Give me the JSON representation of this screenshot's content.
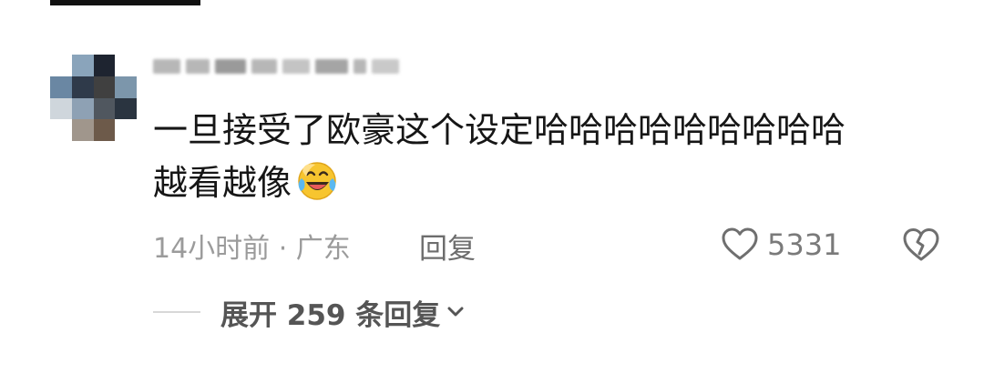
{
  "comment": {
    "text_line1": "一旦接受了欧豪这个设定哈哈哈哈哈哈哈哈哈",
    "text_line2": "越看越像",
    "emoji": "laughing-crying-emoji"
  },
  "meta": {
    "time_location": "14小时前 · 广东",
    "reply_label": "回复"
  },
  "actions": {
    "like_count": "5331",
    "like_icon": "heart-outline-icon",
    "dislike_icon": "broken-heart-icon"
  },
  "replies": {
    "expand_label": "展开 259 条回复",
    "expand_icon": "chevron-down-icon"
  },
  "colors": {
    "text_primary": "#161616",
    "text_meta": "#9b9b9b",
    "icon_gray": "#6f6f6f"
  }
}
